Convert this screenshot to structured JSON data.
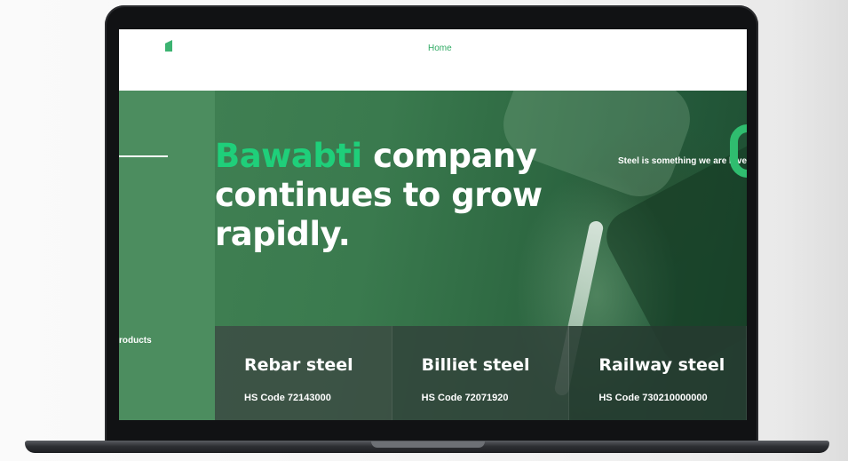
{
  "nav": {
    "home_label": "Home"
  },
  "hero": {
    "headline_accent": "Bawabti",
    "headline_rest": " company continues to grow rapidly.",
    "tagline": "Steel is something we are love",
    "side_label": "roducts"
  },
  "products": [
    {
      "name": "Rebar steel",
      "hs_code": "HS Code 72143000"
    },
    {
      "name": "Billiet steel",
      "hs_code": "HS Code 72071920"
    },
    {
      "name": "Railway steel",
      "hs_code": "HS Code 730210000000"
    }
  ],
  "colors": {
    "brand_green": "#1fcf7a",
    "hero_green": "#4a8b5d",
    "nav_link": "#2faa63"
  }
}
